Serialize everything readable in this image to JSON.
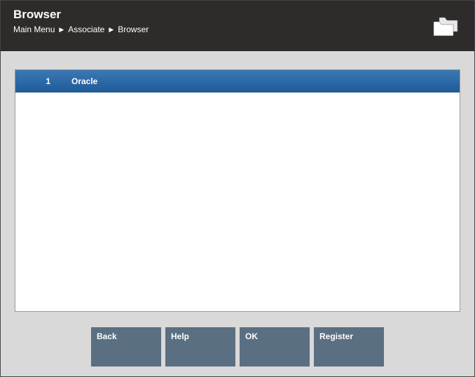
{
  "header": {
    "title": "Browser",
    "breadcrumb": [
      "Main Menu",
      "Associate",
      "Browser"
    ]
  },
  "list": {
    "rows": [
      {
        "index": "1",
        "label": "Oracle"
      }
    ]
  },
  "buttons": {
    "back": "Back",
    "help": "Help",
    "ok": "OK",
    "register": "Register"
  }
}
